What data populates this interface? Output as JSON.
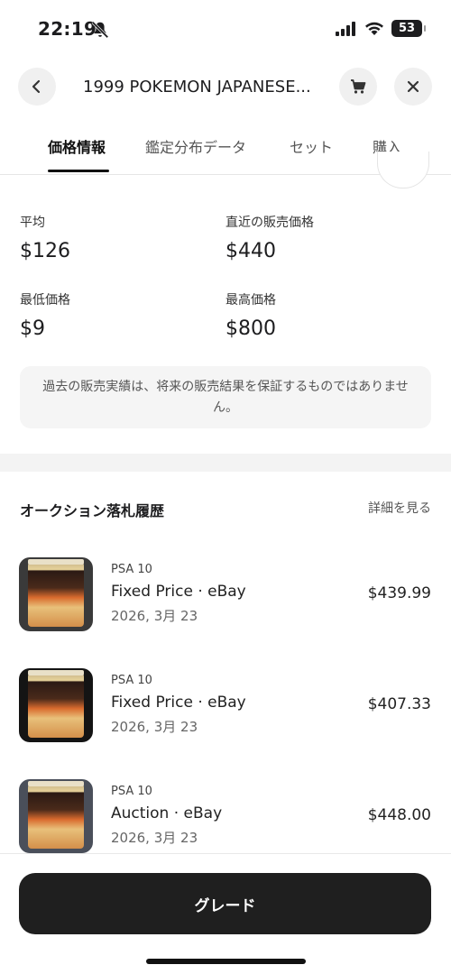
{
  "status_bar": {
    "time": "22:19",
    "battery": "53"
  },
  "header": {
    "title": "1999 POKEMON JAPANESE..."
  },
  "tabs": [
    {
      "label": "価格情報",
      "active": true
    },
    {
      "label": "鑑定分布データ",
      "active": false
    },
    {
      "label": "セット",
      "active": false
    },
    {
      "label": "購入",
      "active": false
    }
  ],
  "stats": {
    "average": {
      "label": "平均",
      "value": "$126"
    },
    "recent": {
      "label": "直近の販売価格",
      "value": "$440"
    },
    "min": {
      "label": "最低価格",
      "value": "$9"
    },
    "max": {
      "label": "最高価格",
      "value": "$800"
    }
  },
  "disclaimer": "過去の販売実績は、将来の販売結果を保証するものではありません。",
  "auction_section": {
    "title": "オークション落札履歴",
    "see_more": "詳細を見る"
  },
  "sales": [
    {
      "grade": "PSA 10",
      "type": "Fixed Price · eBay",
      "date": "2026, 3月 23",
      "price": "$439.99"
    },
    {
      "grade": "PSA 10",
      "type": "Fixed Price · eBay",
      "date": "2026, 3月 23",
      "price": "$407.33"
    },
    {
      "grade": "PSA 10",
      "type": "Auction · eBay",
      "date": "2026, 3月 23",
      "price": "$448.00"
    }
  ],
  "primary_button": "グレード",
  "colors": {
    "accent": "#1f1f1f",
    "muted_bg": "#f5f5f5"
  },
  "icons": [
    "bell-slash-icon",
    "signal-icon",
    "wifi-icon",
    "battery-icon",
    "back-chevron-icon",
    "cart-icon",
    "close-icon"
  ]
}
